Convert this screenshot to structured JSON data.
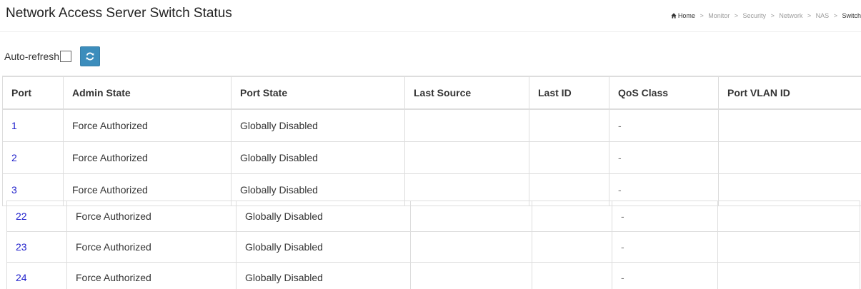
{
  "page_title": "Network Access Server Switch Status",
  "breadcrumb": {
    "home": "Home",
    "items": [
      "Monitor",
      "Security",
      "Network",
      "NAS"
    ],
    "current": "Switch"
  },
  "toolbar": {
    "autorefresh_label": "Auto-refresh",
    "autorefresh_checked": false,
    "refresh_icon": "refresh-icon"
  },
  "table": {
    "columns": [
      "Port",
      "Admin State",
      "Port State",
      "Last Source",
      "Last ID",
      "QoS Class",
      "Port VLAN ID"
    ],
    "rows_top": [
      {
        "port": "1",
        "admin_state": "Force Authorized",
        "port_state": "Globally Disabled",
        "last_source": "",
        "last_id": "",
        "qos_class": "-",
        "port_vlan_id": ""
      },
      {
        "port": "2",
        "admin_state": "Force Authorized",
        "port_state": "Globally Disabled",
        "last_source": "",
        "last_id": "",
        "qos_class": "-",
        "port_vlan_id": ""
      },
      {
        "port": "3",
        "admin_state": "Force Authorized",
        "port_state": "Globally Disabled",
        "last_source": "",
        "last_id": "",
        "qos_class": "-",
        "port_vlan_id": ""
      }
    ],
    "rows_bottom": [
      {
        "port": "22",
        "admin_state": "Force Authorized",
        "port_state": "Globally Disabled",
        "last_source": "",
        "last_id": "",
        "qos_class": "-",
        "port_vlan_id": ""
      },
      {
        "port": "23",
        "admin_state": "Force Authorized",
        "port_state": "Globally Disabled",
        "last_source": "",
        "last_id": "",
        "qos_class": "-",
        "port_vlan_id": ""
      },
      {
        "port": "24",
        "admin_state": "Force Authorized",
        "port_state": "Globally Disabled",
        "last_source": "",
        "last_id": "",
        "qos_class": "-",
        "port_vlan_id": ""
      }
    ]
  },
  "colors": {
    "accent": "#3c8dbc",
    "link": "#2222cc",
    "border": "#dddddd"
  }
}
